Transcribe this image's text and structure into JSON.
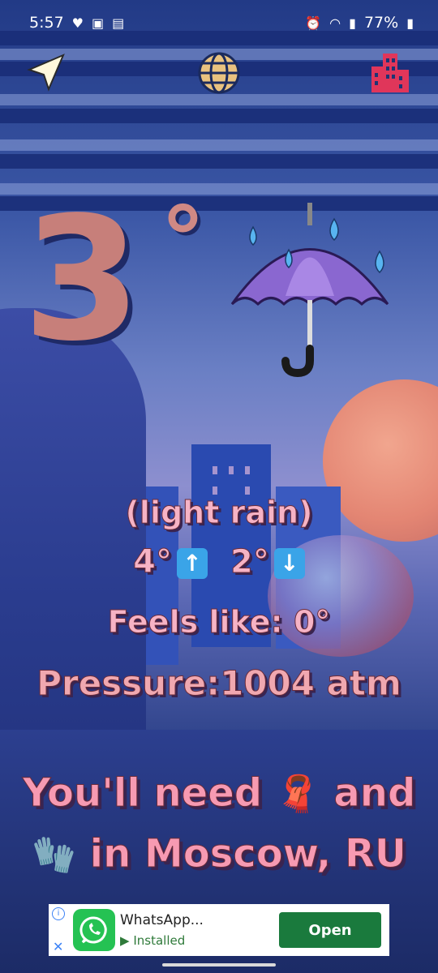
{
  "status_bar": {
    "time": "5:57",
    "battery": "77%"
  },
  "weather": {
    "temperature": "3",
    "degree_symbol": "°",
    "condition": "(light rain)",
    "high": "4°",
    "low": "2°",
    "feels_like": "Feels like: 0°",
    "pressure": "Pressure:1004 atm"
  },
  "advice": {
    "line1_prefix": "You'll need",
    "line1_emoji": "🧣",
    "line1_suffix": "and",
    "line2_emoji": "🧤",
    "line2_suffix": "in Moscow, RU"
  },
  "nav": {
    "location_icon": "navigation-arrow-icon",
    "globe_icon": "globe-icon",
    "city_icon": "city-building-icon"
  },
  "ad": {
    "title": "WhatsApp...",
    "subtitle": "Installed",
    "button": "Open"
  },
  "colors": {
    "temp": "#c77f7a",
    "text_pink": "#f6b3c5",
    "ad_button": "#1a7a3d"
  }
}
